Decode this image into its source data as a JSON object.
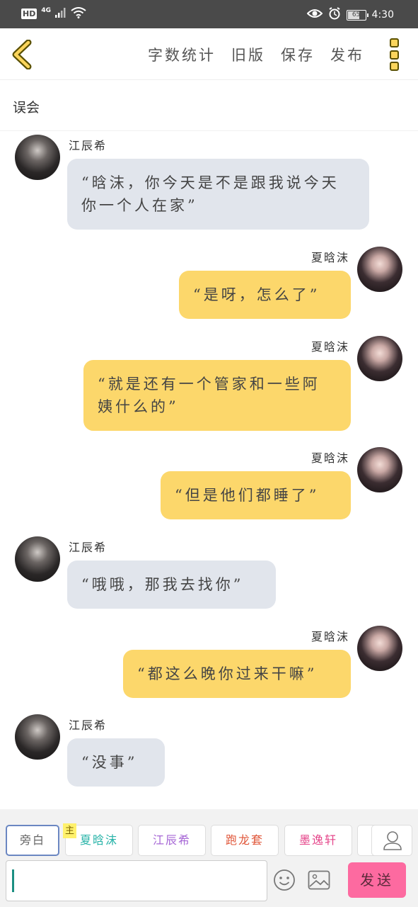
{
  "status_bar": {
    "hd": "HD",
    "network": "4G",
    "battery": "65",
    "time": "4:30"
  },
  "top_bar": {
    "actions": [
      "字数统计",
      "旧版",
      "保存",
      "发布"
    ]
  },
  "title": "误会",
  "messages": [
    {
      "sender": "江辰希",
      "side": "left",
      "text": "“晗沫，你今天是不是跟我说今天你一个人在家”"
    },
    {
      "sender": "夏晗沫",
      "side": "right",
      "text": "“是呀，怎么了”"
    },
    {
      "sender": "夏晗沫",
      "side": "right",
      "text": "“就是还有一个管家和一些阿姨什么的”"
    },
    {
      "sender": "夏晗沫",
      "side": "right",
      "text": "“但是他们都睡了”"
    },
    {
      "sender": "江辰希",
      "side": "left",
      "text": "“哦哦，那我去找你”"
    },
    {
      "sender": "夏晗沫",
      "side": "right",
      "text": "“都这么晚你过来干嘛”"
    },
    {
      "sender": "江辰希",
      "side": "left",
      "text": "“没事”"
    }
  ],
  "roles": [
    {
      "label": "旁白",
      "color": "#666666"
    },
    {
      "label": "夏晗沫",
      "color": "#27b3a8",
      "tag": "主"
    },
    {
      "label": "江辰希",
      "color": "#a768d6"
    },
    {
      "label": "跑龙套",
      "color": "#e0573a"
    },
    {
      "label": "墨逸轩",
      "color": "#e5458a"
    }
  ],
  "input": {
    "value": ""
  },
  "send_label": "发送"
}
